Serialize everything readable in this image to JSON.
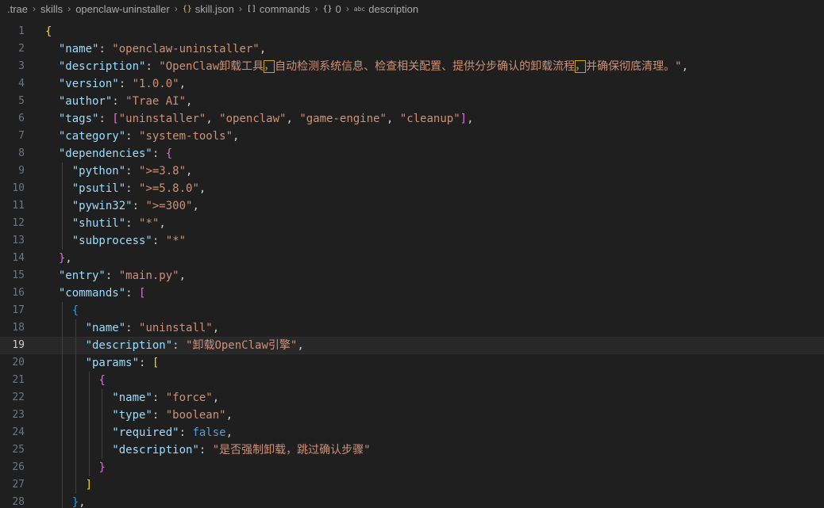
{
  "breadcrumb": [
    {
      "label": ".trae",
      "icon": null
    },
    {
      "label": "skills",
      "icon": null
    },
    {
      "label": "openclaw-uninstaller",
      "icon": null
    },
    {
      "label": "skill.json",
      "icon": "json-file-icon"
    },
    {
      "label": "commands",
      "icon": "array-icon"
    },
    {
      "label": "0",
      "icon": "object-icon"
    },
    {
      "label": "description",
      "icon": "string-icon"
    }
  ],
  "editor": {
    "current_line": 19,
    "colors": {
      "background": "#1f1f1f",
      "key": "#9cdcfe",
      "string": "#ce9178",
      "keyword": "#569cd6",
      "bracket_level1": "#ffd700",
      "bracket_level2": "#da70d6",
      "bracket_level3": "#179fff"
    },
    "lines": [
      {
        "n": "1",
        "indent": 0,
        "tokens": [
          {
            "t": "{",
            "c": "b1"
          }
        ]
      },
      {
        "n": "2",
        "indent": 1,
        "tokens": [
          {
            "t": "\"name\"",
            "c": "key"
          },
          {
            "t": ": ",
            "c": "punc"
          },
          {
            "t": "\"openclaw-uninstaller\"",
            "c": "str"
          },
          {
            "t": ",",
            "c": "punc"
          }
        ]
      },
      {
        "n": "3",
        "indent": 1,
        "tokens": [
          {
            "t": "\"description\"",
            "c": "key"
          },
          {
            "t": ": ",
            "c": "punc"
          },
          {
            "t": "\"OpenClaw卸载工具",
            "c": "str"
          },
          {
            "t": "，",
            "c": "str",
            "box": true
          },
          {
            "t": "自动检测系统信息、检查相关配置、提供分步确认的卸载流程",
            "c": "str"
          },
          {
            "t": "，",
            "c": "str",
            "box": true
          },
          {
            "t": "并确保彻底清理。\"",
            "c": "str"
          },
          {
            "t": ",",
            "c": "punc"
          }
        ]
      },
      {
        "n": "4",
        "indent": 1,
        "tokens": [
          {
            "t": "\"version\"",
            "c": "key"
          },
          {
            "t": ": ",
            "c": "punc"
          },
          {
            "t": "\"1.0.0\"",
            "c": "str"
          },
          {
            "t": ",",
            "c": "punc"
          }
        ]
      },
      {
        "n": "5",
        "indent": 1,
        "tokens": [
          {
            "t": "\"author\"",
            "c": "key"
          },
          {
            "t": ": ",
            "c": "punc"
          },
          {
            "t": "\"Trae AI\"",
            "c": "str"
          },
          {
            "t": ",",
            "c": "punc"
          }
        ]
      },
      {
        "n": "6",
        "indent": 1,
        "tokens": [
          {
            "t": "\"tags\"",
            "c": "key"
          },
          {
            "t": ": ",
            "c": "punc"
          },
          {
            "t": "[",
            "c": "b2"
          },
          {
            "t": "\"uninstaller\"",
            "c": "str"
          },
          {
            "t": ", ",
            "c": "punc"
          },
          {
            "t": "\"openclaw\"",
            "c": "str"
          },
          {
            "t": ", ",
            "c": "punc"
          },
          {
            "t": "\"game-engine\"",
            "c": "str"
          },
          {
            "t": ", ",
            "c": "punc"
          },
          {
            "t": "\"cleanup\"",
            "c": "str"
          },
          {
            "t": "]",
            "c": "b2"
          },
          {
            "t": ",",
            "c": "punc"
          }
        ]
      },
      {
        "n": "7",
        "indent": 1,
        "tokens": [
          {
            "t": "\"category\"",
            "c": "key"
          },
          {
            "t": ": ",
            "c": "punc"
          },
          {
            "t": "\"system-tools\"",
            "c": "str"
          },
          {
            "t": ",",
            "c": "punc"
          }
        ]
      },
      {
        "n": "8",
        "indent": 1,
        "tokens": [
          {
            "t": "\"dependencies\"",
            "c": "key"
          },
          {
            "t": ": ",
            "c": "punc"
          },
          {
            "t": "{",
            "c": "b2"
          }
        ]
      },
      {
        "n": "9",
        "indent": 2,
        "tokens": [
          {
            "t": "\"python\"",
            "c": "key"
          },
          {
            "t": ": ",
            "c": "punc"
          },
          {
            "t": "\">=3.8\"",
            "c": "str"
          },
          {
            "t": ",",
            "c": "punc"
          }
        ]
      },
      {
        "n": "10",
        "indent": 2,
        "tokens": [
          {
            "t": "\"psutil\"",
            "c": "key"
          },
          {
            "t": ": ",
            "c": "punc"
          },
          {
            "t": "\">=5.8.0\"",
            "c": "str"
          },
          {
            "t": ",",
            "c": "punc"
          }
        ]
      },
      {
        "n": "11",
        "indent": 2,
        "tokens": [
          {
            "t": "\"pywin32\"",
            "c": "key"
          },
          {
            "t": ": ",
            "c": "punc"
          },
          {
            "t": "\">=300\"",
            "c": "str"
          },
          {
            "t": ",",
            "c": "punc"
          }
        ]
      },
      {
        "n": "12",
        "indent": 2,
        "tokens": [
          {
            "t": "\"shutil\"",
            "c": "key"
          },
          {
            "t": ": ",
            "c": "punc"
          },
          {
            "t": "\"*\"",
            "c": "str"
          },
          {
            "t": ",",
            "c": "punc"
          }
        ]
      },
      {
        "n": "13",
        "indent": 2,
        "tokens": [
          {
            "t": "\"subprocess\"",
            "c": "key"
          },
          {
            "t": ": ",
            "c": "punc"
          },
          {
            "t": "\"*\"",
            "c": "str"
          }
        ]
      },
      {
        "n": "14",
        "indent": 1,
        "tokens": [
          {
            "t": "}",
            "c": "b2"
          },
          {
            "t": ",",
            "c": "punc"
          }
        ]
      },
      {
        "n": "15",
        "indent": 1,
        "tokens": [
          {
            "t": "\"entry\"",
            "c": "key"
          },
          {
            "t": ": ",
            "c": "punc"
          },
          {
            "t": "\"main.py\"",
            "c": "str"
          },
          {
            "t": ",",
            "c": "punc"
          }
        ]
      },
      {
        "n": "16",
        "indent": 1,
        "tokens": [
          {
            "t": "\"commands\"",
            "c": "key"
          },
          {
            "t": ": ",
            "c": "punc"
          },
          {
            "t": "[",
            "c": "b2"
          }
        ]
      },
      {
        "n": "17",
        "indent": 2,
        "tokens": [
          {
            "t": "{",
            "c": "b3"
          }
        ]
      },
      {
        "n": "18",
        "indent": 3,
        "tokens": [
          {
            "t": "\"name\"",
            "c": "key"
          },
          {
            "t": ": ",
            "c": "punc"
          },
          {
            "t": "\"uninstall\"",
            "c": "str"
          },
          {
            "t": ",",
            "c": "punc"
          }
        ]
      },
      {
        "n": "19",
        "indent": 3,
        "tokens": [
          {
            "t": "\"description\"",
            "c": "key"
          },
          {
            "t": ": ",
            "c": "punc"
          },
          {
            "t": "\"卸载OpenClaw引擎\"",
            "c": "str"
          },
          {
            "t": ",",
            "c": "punc"
          }
        ]
      },
      {
        "n": "20",
        "indent": 3,
        "tokens": [
          {
            "t": "\"params\"",
            "c": "key"
          },
          {
            "t": ": ",
            "c": "punc"
          },
          {
            "t": "[",
            "c": "b1"
          }
        ]
      },
      {
        "n": "21",
        "indent": 4,
        "tokens": [
          {
            "t": "{",
            "c": "b2"
          }
        ]
      },
      {
        "n": "22",
        "indent": 5,
        "tokens": [
          {
            "t": "\"name\"",
            "c": "key"
          },
          {
            "t": ": ",
            "c": "punc"
          },
          {
            "t": "\"force\"",
            "c": "str"
          },
          {
            "t": ",",
            "c": "punc"
          }
        ]
      },
      {
        "n": "23",
        "indent": 5,
        "tokens": [
          {
            "t": "\"type\"",
            "c": "key"
          },
          {
            "t": ": ",
            "c": "punc"
          },
          {
            "t": "\"boolean\"",
            "c": "str"
          },
          {
            "t": ",",
            "c": "punc"
          }
        ]
      },
      {
        "n": "24",
        "indent": 5,
        "tokens": [
          {
            "t": "\"required\"",
            "c": "key"
          },
          {
            "t": ": ",
            "c": "punc"
          },
          {
            "t": "false",
            "c": "kw"
          },
          {
            "t": ",",
            "c": "punc"
          }
        ]
      },
      {
        "n": "25",
        "indent": 5,
        "tokens": [
          {
            "t": "\"description\"",
            "c": "key"
          },
          {
            "t": ": ",
            "c": "punc"
          },
          {
            "t": "\"是否强制卸载，跳过确认步骤\"",
            "c": "str"
          }
        ]
      },
      {
        "n": "26",
        "indent": 4,
        "tokens": [
          {
            "t": "}",
            "c": "b2"
          }
        ]
      },
      {
        "n": "27",
        "indent": 3,
        "tokens": [
          {
            "t": "]",
            "c": "b1"
          }
        ]
      },
      {
        "n": "28",
        "indent": 2,
        "tokens": [
          {
            "t": "}",
            "c": "b3"
          },
          {
            "t": ",",
            "c": "punc"
          }
        ]
      }
    ]
  }
}
